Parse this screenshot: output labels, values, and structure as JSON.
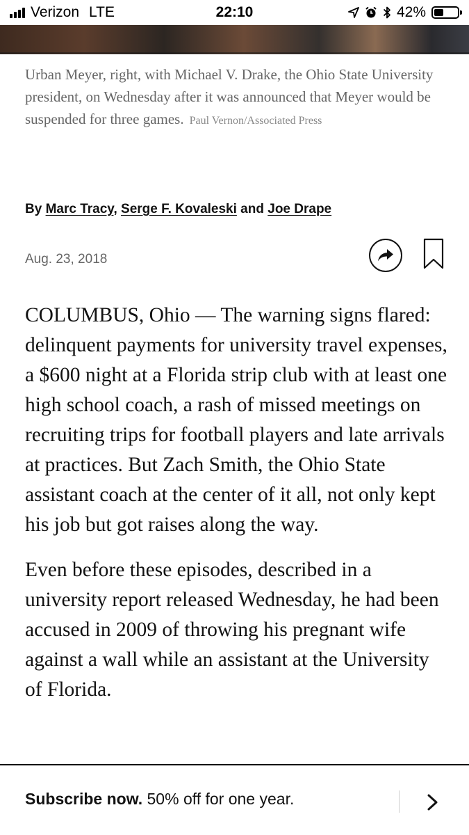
{
  "status_bar": {
    "carrier": "Verizon",
    "network": "LTE",
    "time": "22:10",
    "battery_percent": "42%",
    "battery_level": 0.42
  },
  "caption": {
    "text": "Urban Meyer, right, with Michael V. Drake, the Ohio State University president, on Wednesday after it was announced that Meyer would be suspended for three games.",
    "credit": "Paul Vernon/Associated Press"
  },
  "byline": {
    "prefix": "By ",
    "authors": [
      "Marc Tracy",
      "Serge F. Kovaleski",
      "Joe Drape"
    ],
    "sep1": ", ",
    "sep2": " and "
  },
  "date": "Aug. 23, 2018",
  "icons": {
    "share": "share-arrow-icon",
    "bookmark": "bookmark-icon"
  },
  "article": {
    "paragraphs": [
      "COLUMBUS, Ohio — The warning signs flared: delinquent payments for university travel expenses, a $600 night at a Florida strip club with at least one high school coach, a rash of missed meetings on recruiting trips for football players and late arrivals at practices. But Zach Smith, the Ohio State assistant coach at the center of it all, not only kept his job but got raises along the way.",
      "Even before these episodes, described in a university report released Wednesday, he had been accused in 2009 of throwing his pregnant wife against a wall while an assistant at the University of Florida."
    ]
  },
  "subscribe": {
    "bold": "Subscribe now.",
    "rest": " 50% off for one year."
  }
}
